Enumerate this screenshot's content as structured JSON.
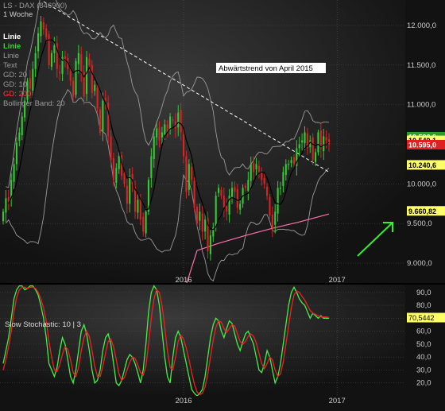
{
  "header": {
    "title": "LS - DAX (846900)",
    "period": "1 Woche"
  },
  "legend": [
    {
      "label": "Linie",
      "color": "#ffffff"
    },
    {
      "label": "Linie",
      "color": "#39d23a"
    },
    {
      "label": "Linie",
      "color": "#9a9a9a"
    },
    {
      "label": "Text",
      "color": "#9a9a9a"
    },
    {
      "label": "GD: 20",
      "color": "#9a9a9a"
    },
    {
      "label": "GD: 10",
      "color": "#9a9a9a"
    },
    {
      "label": "GD: 200",
      "color": "#ff3a3a"
    },
    {
      "label": "Bollinger Band: 20",
      "color": "#9a9a9a"
    }
  ],
  "annotation": {
    "text": "Abwärtstrend von April 2015"
  },
  "price_tags": [
    {
      "text": "10.596,0",
      "bg": "#2e9a2e",
      "fg": "#ffffff",
      "value": 10596
    },
    {
      "text": "10.549,1",
      "bg": "#ffff66",
      "fg": "#000000",
      "value": 10549
    },
    {
      "text": "10.595,0",
      "bg": "#e02020",
      "fg": "#ffffff",
      "value": 10495
    },
    {
      "text": "10.240,6",
      "bg": "#ffff66",
      "fg": "#000000",
      "value": 10240
    },
    {
      "text": "9.660,82",
      "bg": "#ffff66",
      "fg": "#000000",
      "value": 9660
    }
  ],
  "stoch_tag": {
    "text": "70,5442",
    "value": 70.5
  },
  "stoch_label": "Slow Stochastic: 10 | 3",
  "colors": {
    "background": "#121212",
    "up_candle": "#33cc33",
    "down_candle": "#dd2222",
    "gd200": "#ff6fa8",
    "stoch_k": "#44ee44",
    "stoch_d": "#ee2222",
    "trend_arrow": "#33ee33"
  },
  "chart_data": [
    {
      "type": "candlestick",
      "title": "LS - DAX (846900)",
      "subtitle": "1 Woche",
      "y_axis_side": "right",
      "yticks": [
        9000,
        9500,
        10000,
        10500,
        11000,
        11500,
        12000
      ],
      "ytick_labels": [
        "9.000,0",
        "9.500,0",
        "10.000,0",
        "10.500,0",
        "11.000,0",
        "11.500,0",
        "12.000,0"
      ],
      "ylim": [
        8750,
        12320
      ],
      "x_tick_labels": [
        "2016",
        "2017"
      ],
      "x_tick_index": [
        67,
        124
      ],
      "n_bars": 122,
      "close": [
        9650,
        9820,
        9780,
        10050,
        10250,
        10520,
        10650,
        10850,
        11050,
        11300,
        11200,
        11450,
        11650,
        11900,
        12050,
        11950,
        11850,
        11500,
        11650,
        11750,
        11450,
        11400,
        11600,
        11550,
        11450,
        11300,
        11100,
        11550,
        11650,
        11400,
        11100,
        11600,
        11500,
        11150,
        11250,
        10950,
        10650,
        11050,
        11050,
        10600,
        10300,
        10050,
        10200,
        10350,
        10100,
        10000,
        9750,
        10100,
        10000,
        9650,
        9800,
        9550,
        9400,
        9650,
        10050,
        10350,
        10600,
        10700,
        10550,
        10650,
        10750,
        10650,
        10850,
        10800,
        10700,
        10900,
        10650,
        10350,
        9900,
        10250,
        10050,
        9700,
        9500,
        9650,
        9400,
        9550,
        9150,
        9350,
        9450,
        9850,
        9950,
        9850,
        9700,
        9650,
        9850,
        9950,
        9900,
        9700,
        9750,
        9950,
        9950,
        10050,
        10250,
        10150,
        10250,
        10150,
        10050,
        10000,
        9850,
        9600,
        9450,
        9650,
        9950,
        9950,
        10150,
        10250,
        10250,
        10300,
        10250,
        10450,
        10500,
        10550,
        10650,
        10450,
        10550,
        10300,
        10400,
        10650,
        10450,
        10600,
        10550,
        10500
      ],
      "ma_gd10_color": "#000000",
      "ma_gd200": [
        [
          72,
          9160
        ],
        [
          80,
          9250
        ],
        [
          90,
          9350
        ],
        [
          100,
          9440
        ],
        [
          110,
          9520
        ],
        [
          121,
          9620
        ]
      ],
      "bollinger_upper_range": [
        12300,
        11000
      ],
      "bollinger_lower_range": [
        8780,
        9500
      ],
      "trendline": {
        "label": "Abwärtstrend von April 2015",
        "from": [
          15,
          12300
        ],
        "to": [
          121,
          10150
        ]
      }
    },
    {
      "type": "line",
      "title": "Slow Stochastic: 10 | 3",
      "yticks": [
        20,
        30,
        40,
        50,
        60,
        70,
        80,
        90
      ],
      "ytick_labels": [
        "20,0",
        "30,0",
        "40,0",
        "50,0",
        "60,0",
        "70,0",
        "80,0",
        "90,0"
      ],
      "ylim": [
        10,
        96
      ],
      "x_tick_labels": [
        "2016",
        "2017"
      ],
      "series": [
        {
          "values": [
            35,
            45,
            55,
            70,
            85,
            92,
            95,
            95,
            92,
            93,
            95,
            95,
            92,
            88,
            80,
            70,
            55,
            35,
            30,
            25,
            32,
            45,
            55,
            50,
            38,
            25,
            20,
            30,
            45,
            60,
            65,
            58,
            45,
            30,
            20,
            22,
            30,
            45,
            55,
            58,
            50,
            35,
            20,
            18,
            22,
            30,
            38,
            42,
            40,
            35,
            28,
            20,
            30,
            50,
            75,
            90,
            95,
            92,
            80,
            60,
            40,
            25,
            20,
            40,
            55,
            60,
            55,
            45,
            35,
            25,
            15,
            12,
            10,
            12,
            15,
            25,
            40,
            55,
            65,
            70,
            68,
            60,
            55,
            62,
            68,
            66,
            58,
            50,
            45,
            52,
            58,
            60,
            55,
            50,
            40,
            30,
            28,
            35,
            45,
            40,
            30,
            20,
            25,
            35,
            50,
            65,
            80,
            90,
            94,
            90,
            85,
            82,
            80,
            75,
            70,
            74,
            72,
            70,
            72,
            70,
            70,
            70
          ]
        },
        {
          "values": [
            30,
            38,
            48,
            60,
            75,
            86,
            92,
            94,
            94,
            93,
            94,
            94,
            93,
            90,
            85,
            78,
            68,
            52,
            40,
            30,
            29,
            34,
            42,
            48,
            46,
            38,
            28,
            25,
            32,
            45,
            55,
            60,
            56,
            45,
            33,
            25,
            25,
            33,
            43,
            52,
            54,
            48,
            38,
            27,
            22,
            24,
            30,
            36,
            40,
            39,
            34,
            28,
            26,
            33,
            50,
            70,
            85,
            92,
            90,
            80,
            63,
            45,
            32,
            30,
            40,
            52,
            57,
            54,
            47,
            38,
            28,
            19,
            13,
            11,
            12,
            17,
            27,
            40,
            53,
            63,
            68,
            67,
            62,
            59,
            62,
            65,
            64,
            58,
            52,
            50,
            52,
            56,
            58,
            56,
            51,
            43,
            35,
            31,
            35,
            40,
            38,
            30,
            25,
            27,
            36,
            50,
            64,
            78,
            88,
            91,
            90,
            87,
            84,
            80,
            76,
            74,
            73,
            72,
            71,
            71,
            71,
            70.5
          ]
        }
      ]
    }
  ]
}
